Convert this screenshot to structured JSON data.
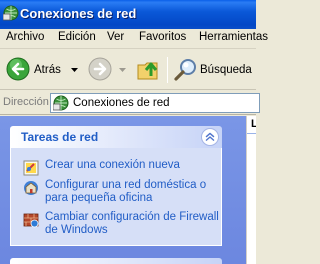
{
  "window": {
    "title": "Conexiones de red",
    "icon": "network-connections-icon"
  },
  "menu": [
    "Archivo",
    "Edición",
    "Ver",
    "Favoritos",
    "Herramientas"
  ],
  "toolbar": {
    "back_label": "Atrás",
    "search_label": "Búsqueda"
  },
  "address": {
    "label": "Dirección",
    "value": "Conexiones de red"
  },
  "task_panel": {
    "title": "Tareas de red",
    "items": [
      {
        "label": "Crear una conexión nueva",
        "icon": "new-connection-icon"
      },
      {
        "label": "Configurar una red doméstica o para pequeña oficina",
        "icon": "home-network-icon"
      },
      {
        "label": "Cambiar configuración de Firewall de Windows",
        "icon": "firewall-icon"
      }
    ]
  },
  "right_pane": {
    "header_initial": "L"
  },
  "colors": {
    "titlebar": "#0a58d8",
    "task_link": "#215dc6",
    "panel_bg": "#d6dff7",
    "pane_bg": "#7b98e8"
  }
}
